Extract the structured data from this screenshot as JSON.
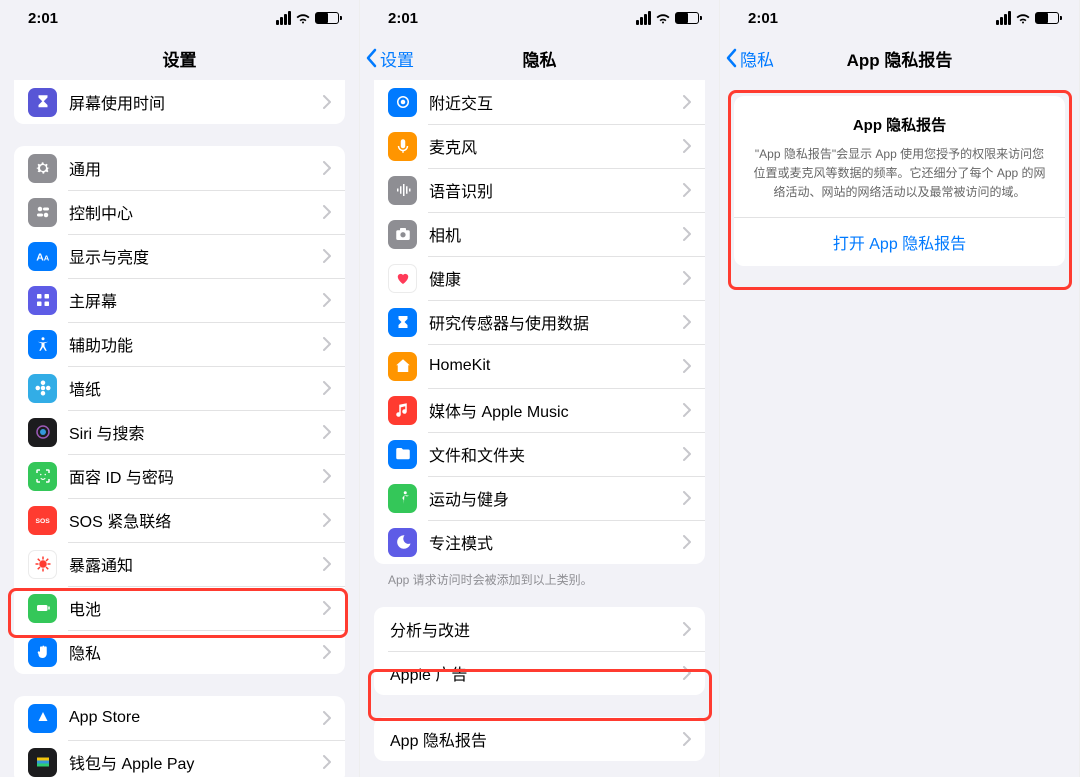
{
  "status": {
    "time": "2:01"
  },
  "screen1": {
    "title": "设置",
    "group0": [
      {
        "label": "屏幕使用时间"
      }
    ],
    "group1": [
      {
        "label": "通用"
      },
      {
        "label": "控制中心"
      },
      {
        "label": "显示与亮度"
      },
      {
        "label": "主屏幕"
      },
      {
        "label": "辅助功能"
      },
      {
        "label": "墙纸"
      },
      {
        "label": "Siri 与搜索"
      },
      {
        "label": "面容 ID 与密码"
      },
      {
        "label": "SOS 紧急联络"
      },
      {
        "label": "暴露通知"
      },
      {
        "label": "电池"
      },
      {
        "label": "隐私"
      }
    ],
    "group2": [
      {
        "label": "App Store"
      },
      {
        "label": "钱包与 Apple Pay"
      }
    ]
  },
  "screen2": {
    "back": "设置",
    "title": "隐私",
    "group1": [
      {
        "label": "附近交互"
      },
      {
        "label": "麦克风"
      },
      {
        "label": "语音识别"
      },
      {
        "label": "相机"
      },
      {
        "label": "健康"
      },
      {
        "label": "研究传感器与使用数据"
      },
      {
        "label": "HomeKit"
      },
      {
        "label": "媒体与 Apple Music"
      },
      {
        "label": "文件和文件夹"
      },
      {
        "label": "运动与健身"
      },
      {
        "label": "专注模式"
      }
    ],
    "footnote": "App 请求访问时会被添加到以上类别。",
    "group2": [
      {
        "label": "分析与改进"
      },
      {
        "label": "Apple 广告"
      }
    ],
    "group3": [
      {
        "label": "App 隐私报告"
      }
    ]
  },
  "screen3": {
    "back": "隐私",
    "title": "App 隐私报告",
    "card": {
      "title": "App 隐私报告",
      "text": "\"App 隐私报告\"会显示 App 使用您授予的权限来访问您位置或麦克风等数据的频率。它还细分了每个 App 的网络活动、网站的网络活动以及最常被访问的域。",
      "action": "打开 App 隐私报告"
    }
  }
}
